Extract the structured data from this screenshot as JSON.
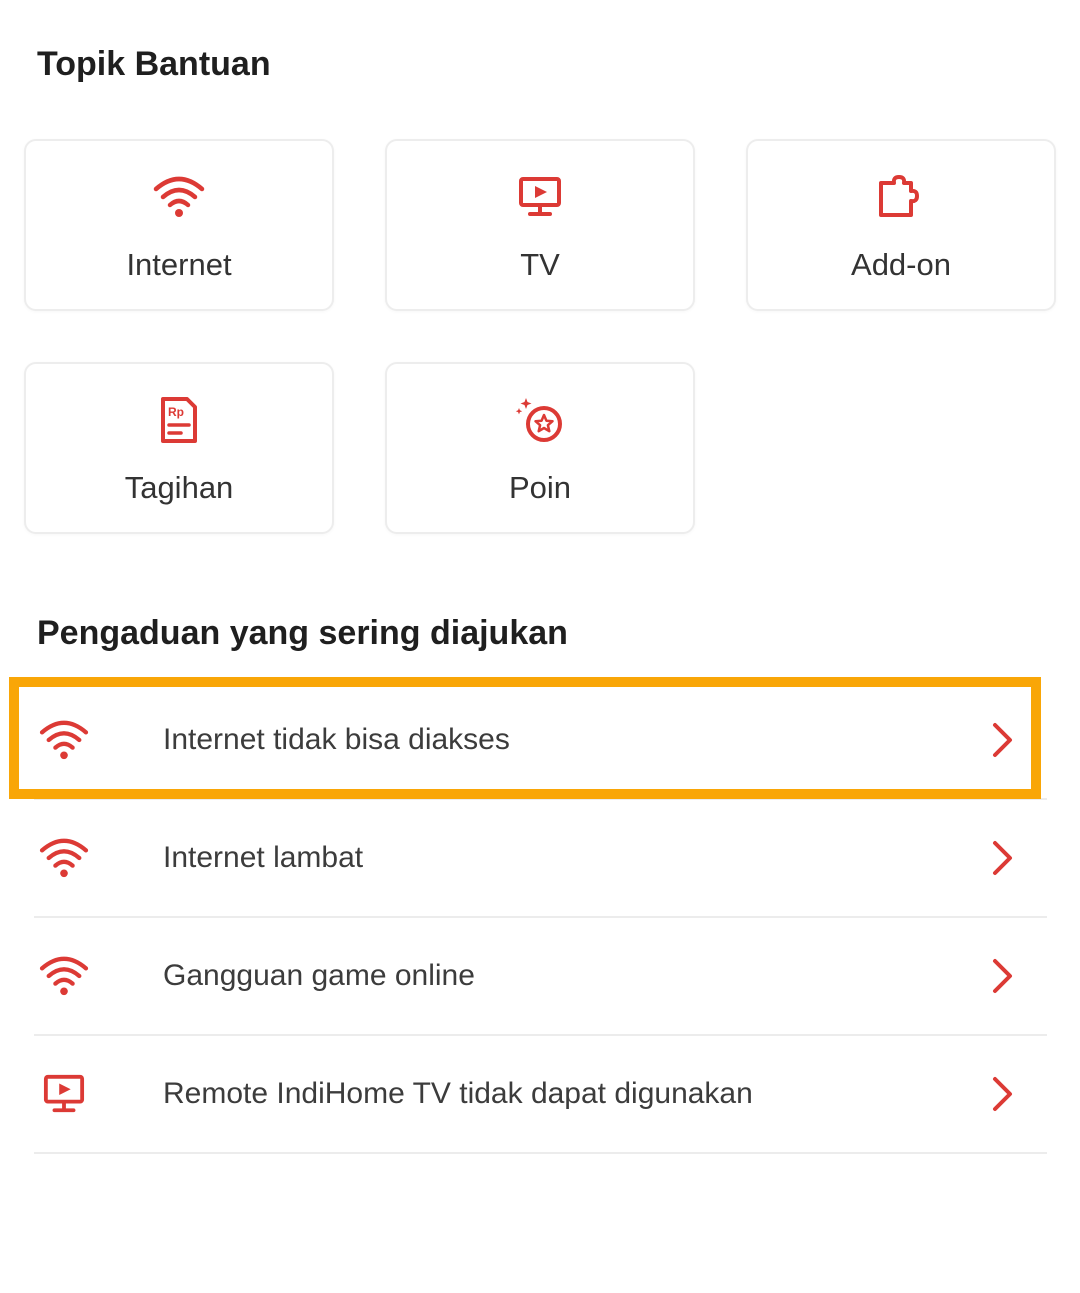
{
  "topik": {
    "title": "Topik Bantuan",
    "cards": [
      {
        "label": "Internet",
        "icon": "wifi-icon"
      },
      {
        "label": "TV",
        "icon": "tv-icon"
      },
      {
        "label": "Add-on",
        "icon": "puzzle-icon"
      },
      {
        "label": "Tagihan",
        "icon": "bill-icon"
      },
      {
        "label": "Poin",
        "icon": "poin-icon"
      }
    ]
  },
  "pengaduan": {
    "title": "Pengaduan yang sering diajukan",
    "items": [
      {
        "label": "Internet tidak bisa diakses",
        "icon": "wifi-icon"
      },
      {
        "label": "Internet lambat",
        "icon": "wifi-icon"
      },
      {
        "label": "Gangguan game online",
        "icon": "wifi-icon"
      },
      {
        "label": "Remote IndiHome TV tidak dapat digunakan",
        "icon": "tv-icon"
      }
    ]
  },
  "colors": {
    "accent": "#dc3a35",
    "highlight": "#f9a607",
    "divider": "#ececec",
    "card_border": "#ededed"
  }
}
